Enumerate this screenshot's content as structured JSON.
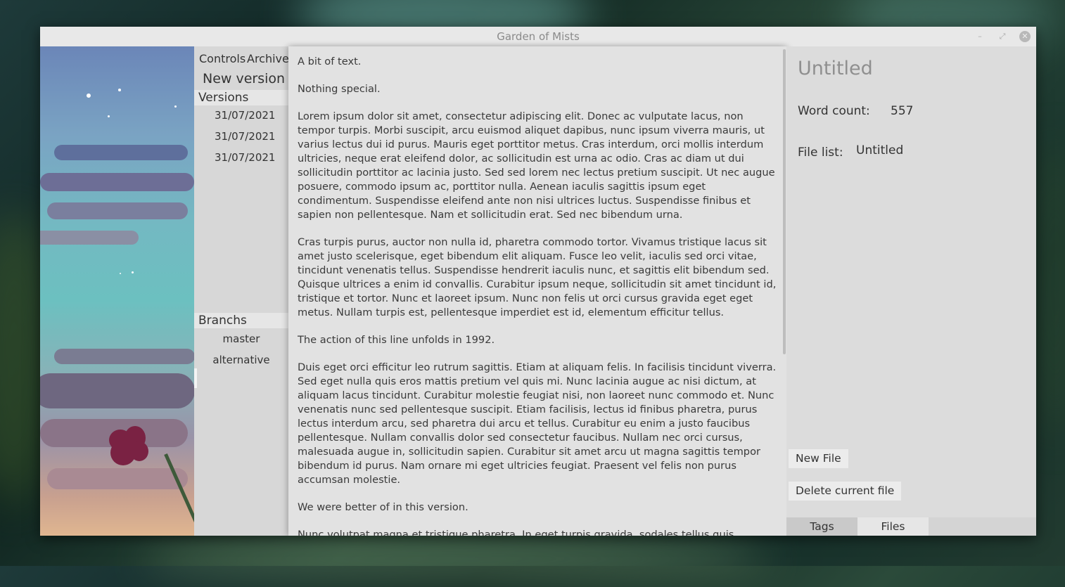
{
  "window": {
    "title": "Garden of Mists",
    "minimize_glyph": "–",
    "maximize_glyph": "⤢",
    "close_glyph": "✕"
  },
  "left_panel": {
    "menu": [
      "Controls",
      "Archive"
    ],
    "new_version_label": "New version",
    "versions_header": "Versions",
    "versions": [
      "31/07/2021",
      "31/07/2021",
      "31/07/2021"
    ],
    "branches_header": "Branchs",
    "branches": [
      "master",
      "alternative"
    ],
    "selected_branch": "alternative"
  },
  "editor": {
    "paragraphs": [
      "A bit of text.",
      "Nothing special.",
      "Lorem ipsum dolor sit amet, consectetur adipiscing elit. Donec ac vulputate lacus, non tempor turpis. Morbi suscipit, arcu euismod aliquet dapibus, nunc ipsum viverra mauris, ut varius lectus dui id purus. Mauris eget porttitor metus. Cras interdum, orci mollis interdum ultricies, neque erat eleifend dolor, ac sollicitudin est urna ac odio. Cras ac diam ut dui sollicitudin porttitor ac lacinia justo. Sed sed lorem nec lectus pretium suscipit. Ut nec augue posuere, commodo ipsum ac, porttitor nulla. Aenean iaculis sagittis ipsum eget condimentum. Suspendisse eleifend ante non nisi ultrices luctus. Suspendisse finibus et sapien non pellentesque. Nam et sollicitudin erat. Sed nec bibendum urna.",
      "Cras turpis purus, auctor non nulla id, pharetra commodo tortor. Vivamus tristique lacus sit amet justo scelerisque, eget bibendum elit aliquam. Fusce leo velit, iaculis sed orci vitae, tincidunt venenatis tellus. Suspendisse hendrerit iaculis nunc, et sagittis elit bibendum sed. Quisque ultrices a enim id convallis. Curabitur ipsum neque, sollicitudin sit amet tincidunt id, tristique et tortor. Nunc et laoreet ipsum. Nunc non felis ut orci cursus gravida eget eget metus. Nullam turpis est, pellentesque imperdiet est id, elementum efficitur tellus.",
      "The action of this line unfolds in 1992.",
      "Duis eget orci efficitur leo rutrum sagittis. Etiam at aliquam felis. In facilisis tincidunt viverra. Sed eget nulla quis eros mattis pretium vel quis mi. Nunc lacinia augue ac nisi dictum, at aliquam lacus tincidunt. Curabitur molestie feugiat nisi, non laoreet nunc commodo et. Nunc venenatis nunc sed pellentesque suscipit. Etiam facilisis, lectus id finibus pharetra, purus lectus interdum arcu, sed pharetra dui arcu et tellus. Curabitur eu enim a justo faucibus pellentesque. Nullam convallis dolor sed consectetur faucibus. Nullam nec orci cursus, malesuada augue in, sollicitudin sapien. Curabitur sit amet arcu ut magna sagittis tempor bibendum id purus. Nam ornare mi eget ultricies feugiat. Praesent vel felis non purus accumsan molestie.",
      "We were better of in this version.",
      "Nunc volutpat magna et tristique pharetra. In eget turpis gravida, sodales tellus quis, molestie augue. Aliquam dolor velit, rutrum eu lacus vitae, eleifend aliquam justo. Nunc nec justo sed"
    ]
  },
  "right_panel": {
    "document_title": "Untitled",
    "word_count_label": "Word count:",
    "word_count_value": "557",
    "file_list_label": "File list:",
    "files": [
      "Untitled"
    ],
    "new_file_label": "New File",
    "delete_file_label": "Delete current file",
    "tabs": [
      "Tags",
      "Files"
    ],
    "active_tab": "Files"
  }
}
